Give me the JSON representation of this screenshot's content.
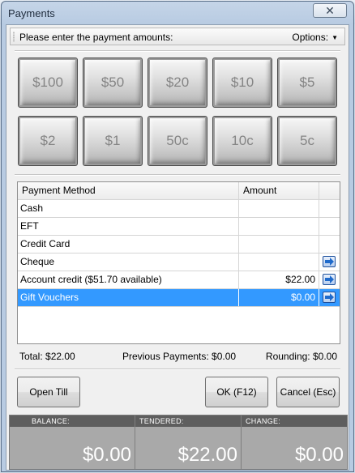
{
  "window": {
    "title": "Payments",
    "close_glyph": "✕"
  },
  "toolbar": {
    "prompt": "Please enter the payment amounts:",
    "options_label": "Options:",
    "options_arrow": "▼"
  },
  "denominations": {
    "row1": [
      "$100",
      "$50",
      "$20",
      "$10",
      "$5"
    ],
    "row2": [
      "$2",
      "$1",
      "50c",
      "10c",
      "5c"
    ]
  },
  "table": {
    "headers": {
      "method": "Payment Method",
      "amount": "Amount"
    },
    "rows": [
      {
        "method": "Cash",
        "amount": "",
        "go": false
      },
      {
        "method": "EFT",
        "amount": "",
        "go": false
      },
      {
        "method": "Credit Card",
        "amount": "",
        "go": false
      },
      {
        "method": "Cheque",
        "amount": "",
        "go": true
      },
      {
        "method": "Account credit ($51.70 available)",
        "amount": "$22.00",
        "go": true
      },
      {
        "method": "Gift Vouchers",
        "amount": "$0.00",
        "go": true,
        "selected": true
      }
    ]
  },
  "totals": {
    "total": "Total: $22.00",
    "previous": "Previous Payments: $0.00",
    "rounding": "Rounding: $0.00"
  },
  "buttons": {
    "open_till": "Open Till",
    "ok": "OK (F12)",
    "cancel": "Cancel (Esc)"
  },
  "summary": {
    "balance_label": "BALANCE:",
    "balance_value": "$0.00",
    "tendered_label": "TENDERED:",
    "tendered_value": "$22.00",
    "change_label": "CHANGE:",
    "change_value": "$0.00"
  },
  "colors": {
    "selected_row": "#3399ff",
    "summary_bg": "#a9a9a9",
    "summary_header": "#5e5e5e"
  }
}
